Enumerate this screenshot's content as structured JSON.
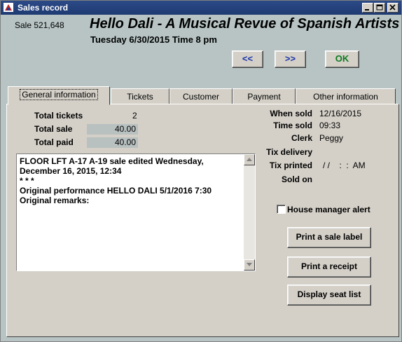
{
  "window": {
    "title": "Sales record",
    "icon": "app-icon",
    "controls": [
      "minimize-icon",
      "maximize-icon",
      "close-icon"
    ]
  },
  "header": {
    "sale_number": "Sale 521,648",
    "show_title": "Hello Dali - A Musical Revue of Spanish Artists",
    "performance_date": "Tuesday 6/30/2015  Time 8 pm"
  },
  "toolbar": {
    "prev_label": "<<",
    "next_label": ">>",
    "ok_label": "OK"
  },
  "tabs": [
    {
      "label": "General information",
      "active": true
    },
    {
      "label": "Tickets",
      "active": false
    },
    {
      "label": "Customer",
      "active": false
    },
    {
      "label": "Payment",
      "active": false
    },
    {
      "label": "Other information",
      "active": false
    }
  ],
  "general": {
    "total_tickets_label": "Total tickets",
    "total_tickets": "2",
    "total_sale_label": "Total sale",
    "total_sale": "40.00",
    "total_paid_label": "Total paid",
    "total_paid": "40.00",
    "remarks": [
      "FLOOR LFT A-17 A-19 sale edited Wednesday, December 16, 2015, 12:34",
      "* * *",
      "Original performance HELLO DALI 5/1/2016 7:30",
      "Original remarks:"
    ],
    "when_sold_label": "When sold",
    "when_sold": "12/16/2015",
    "time_sold_label": "Time sold",
    "time_sold": "09:33",
    "clerk_label": "Clerk",
    "clerk": "Peggy",
    "tix_delivery_label": "Tix delivery",
    "tix_delivery": "",
    "tix_printed_label": "Tix printed",
    "tix_printed": "/ /    :  :  AM",
    "sold_on_label": "Sold on",
    "sold_on": "",
    "house_manager_alert_label": "House manager alert",
    "house_manager_alert": false
  },
  "actions": {
    "print_sale_label": "Print a sale label",
    "print_receipt": "Print a receipt",
    "display_seat_list": "Display seat list"
  },
  "colors": {
    "window_bg": "#b8c4c4",
    "panel_bg": "#d4d0c8",
    "titlebar": "#1e3a73",
    "nav_arrows": "#1a34a8",
    "ok": "#0a7a1e"
  }
}
